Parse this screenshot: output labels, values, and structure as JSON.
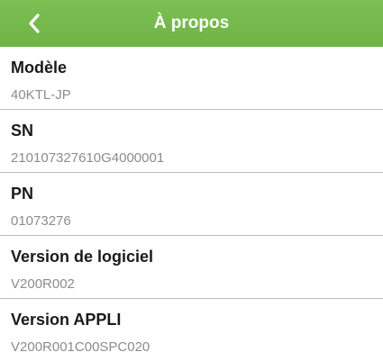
{
  "header": {
    "title": "À propos",
    "back_icon": "chevron-left-icon",
    "background_color": "#74b94c"
  },
  "items": [
    {
      "label": "Modèle",
      "value": "40KTL-JP"
    },
    {
      "label": "SN",
      "value": "210107327610G4000001"
    },
    {
      "label": "PN",
      "value": "01073276"
    },
    {
      "label": "Version de logiciel",
      "value": "V200R002"
    },
    {
      "label": "Version APPLI",
      "value": "V200R001C00SPC020"
    }
  ]
}
